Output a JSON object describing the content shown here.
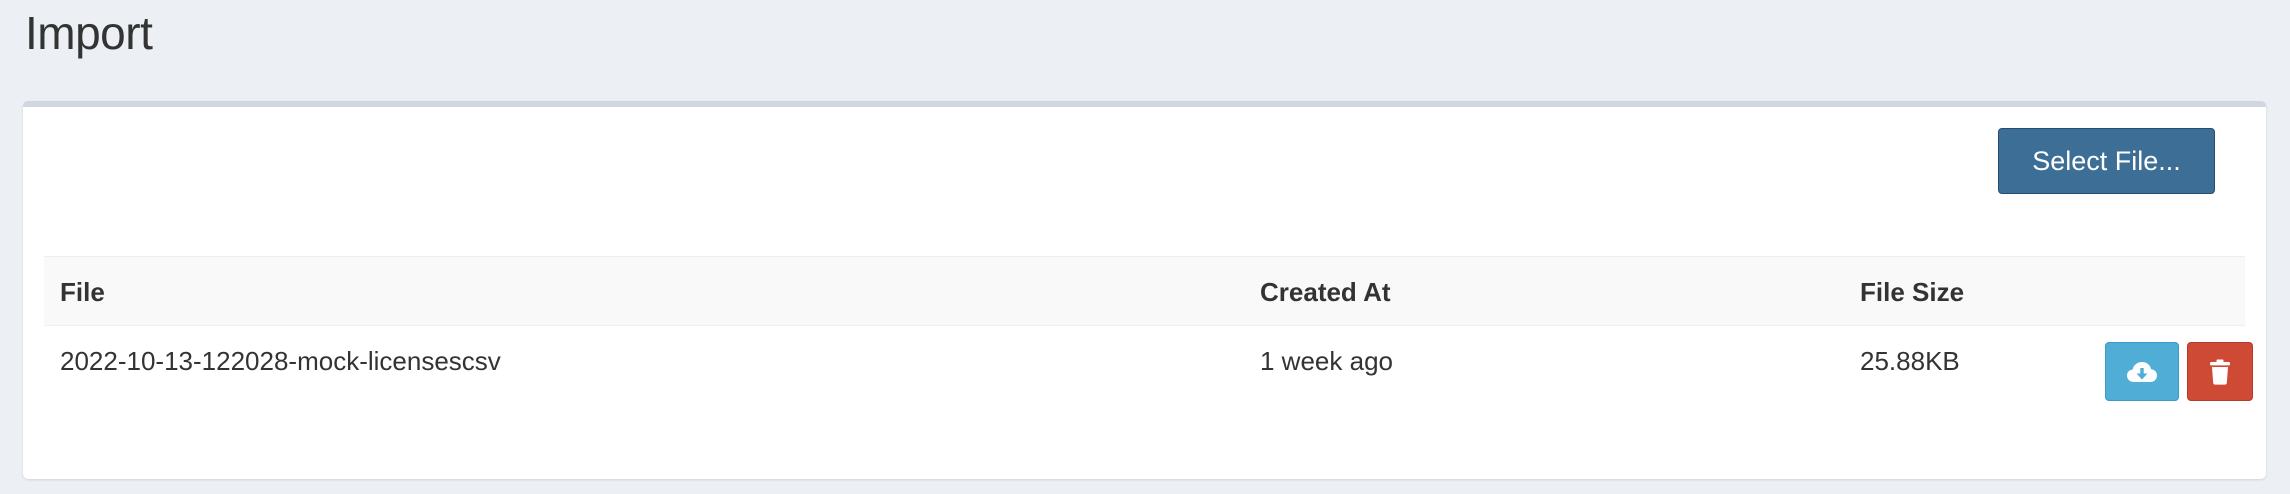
{
  "page": {
    "title": "Import"
  },
  "toolbar": {
    "select_file_label": "Select File..."
  },
  "table": {
    "columns": [
      "File",
      "Created At",
      "File Size"
    ],
    "rows": [
      {
        "file": "2022-10-13-122028-mock-licensescsv",
        "created_at": "1 week ago",
        "file_size": "25.88KB",
        "actions": [
          {
            "icon": "cloud-download-icon",
            "color": "#4fadd6"
          },
          {
            "icon": "trash-icon",
            "color": "#cf4a35"
          }
        ]
      }
    ]
  },
  "colors": {
    "page_background": "#ecf0f5",
    "primary_button": "#3c6e96",
    "info_button": "#4fadd6",
    "danger_button": "#cf4a35"
  }
}
